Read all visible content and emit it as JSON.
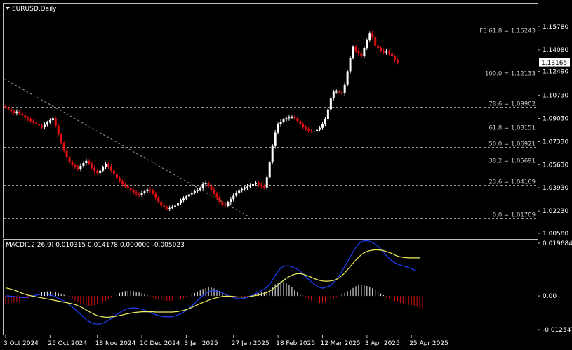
{
  "chart_data": {
    "type": "candlestick",
    "symbol_title": "EURUSD,Daily",
    "price_axis": {
      "ylim": [
        1.0058,
        1.1578
      ],
      "ticks": [
        "1.15780",
        "1.14080",
        "1.12490",
        "1.10730",
        "1.09030",
        "1.07330",
        "1.05630",
        "1.03930",
        "1.02230",
        "1.00580"
      ],
      "tick_values": [
        1.1578,
        1.1408,
        1.1249,
        1.1073,
        1.0903,
        1.0733,
        1.0563,
        1.0393,
        1.0223,
        1.0058
      ],
      "current_price": "1.13165",
      "current_value": 1.13165
    },
    "fib_levels": [
      {
        "label": "FE 61.8 = 1.15243",
        "value": 1.15243
      },
      {
        "label": "100.0 = 1.12133",
        "value": 1.12133
      },
      {
        "label": "78.6 = 1.09902",
        "value": 1.09902
      },
      {
        "label": "61.8 = 1.08151",
        "value": 1.08151
      },
      {
        "label": "50.0 = 1.06921",
        "value": 1.06921
      },
      {
        "label": "38.2 = 1.05691",
        "value": 1.05691
      },
      {
        "label": "23.6 = 1.04169",
        "value": 1.04169
      },
      {
        "label": "0.0 = 1.01709",
        "value": 1.01709
      }
    ],
    "trendline": {
      "from": [
        "3 Oct 2024",
        1.1195
      ],
      "to": [
        "10 Feb 2025",
        1.0175
      ]
    },
    "x_axis": {
      "labels": [
        "3 Oct 2024",
        "25 Oct 2024",
        "18 Nov 2024",
        "10 Dec 2024",
        "3 Jan 2025",
        "27 Jan 2025",
        "18 Feb 2025",
        "12 Mar 2025",
        "3 Apr 2025",
        "25 Apr 2025"
      ],
      "label_bar_index": [
        0,
        16,
        33,
        49,
        65,
        82,
        98,
        114,
        130,
        146
      ]
    },
    "candle_count": 152,
    "close_series": [
      1.0985,
      1.0972,
      1.0957,
      1.0942,
      1.0954,
      1.0938,
      1.0925,
      1.0908,
      1.0896,
      1.0884,
      1.0872,
      1.0862,
      1.0852,
      1.0842,
      1.0858,
      1.0874,
      1.089,
      1.0905,
      1.085,
      1.0785,
      1.0725,
      1.0665,
      1.0615,
      1.0582,
      1.056,
      1.0545,
      1.053,
      1.0555,
      1.0575,
      1.0592,
      1.057,
      1.054,
      1.0515,
      1.0502,
      1.052,
      1.0545,
      1.0565,
      1.055,
      1.052,
      1.0492,
      1.0465,
      1.044,
      1.042,
      1.0405,
      1.039,
      1.0375,
      1.036,
      1.0348,
      1.034,
      1.0355,
      1.0368,
      1.038,
      1.0372,
      1.035,
      1.032,
      1.029,
      1.0262,
      1.025,
      1.024,
      1.0245,
      1.0255,
      1.0262,
      1.028,
      1.03,
      1.0315,
      1.033,
      1.0345,
      1.0358,
      1.0368,
      1.0378,
      1.039,
      1.042,
      1.043,
      1.0405,
      1.038,
      1.035,
      1.032,
      1.029,
      1.027,
      1.026,
      1.0285,
      1.031,
      1.0335,
      1.0355,
      1.0372,
      1.0385,
      1.0395,
      1.0402,
      1.041,
      1.042,
      1.043,
      1.0415,
      1.0405,
      1.0395,
      1.047,
      1.058,
      1.07,
      1.08,
      1.086,
      1.088,
      1.0895,
      1.0905,
      1.091,
      1.0912,
      1.0905,
      1.0885,
      1.086,
      1.084,
      1.0825,
      1.0815,
      1.081,
      1.0812,
      1.082,
      1.0835,
      1.086,
      1.09,
      1.097,
      1.105,
      1.11,
      1.11,
      1.1095,
      1.109,
      1.115,
      1.125,
      1.135,
      1.143,
      1.14,
      1.138,
      1.136,
      1.142,
      1.148,
      1.153,
      1.15,
      1.144,
      1.142,
      1.14,
      1.139,
      1.1395,
      1.138,
      1.136,
      1.133,
      1.1316
    ],
    "macd": {
      "title": "MACD(12,26,9) 0.010315 0.014178 0.000000 -0.005023",
      "ylim": [
        -0.012547,
        0.019684
      ],
      "ticks": [
        "0.019684",
        "0.00",
        "-0.012547"
      ],
      "tick_values": [
        0.019684,
        0.0,
        -0.012547
      ],
      "histogram": [
        -0.003,
        -0.0028,
        -0.0026,
        -0.0024,
        -0.0022,
        -0.0019,
        -0.0016,
        -0.0012,
        -0.0008,
        -0.0004,
        0.0001,
        0.0006,
        0.001,
        0.0013,
        0.0016,
        0.0017,
        0.0017,
        0.0016,
        0.0014,
        0.0011,
        0.0008,
        0.0004,
        0.0,
        -0.0006,
        -0.0012,
        -0.0018,
        -0.0024,
        -0.0029,
        -0.0033,
        -0.0036,
        -0.0037,
        -0.0037,
        -0.0035,
        -0.0032,
        -0.0028,
        -0.0023,
        -0.0018,
        -0.0012,
        -0.0006,
        0.0001,
        0.0006,
        0.0011,
        0.0015,
        0.0018,
        0.0019,
        0.0019,
        0.0018,
        0.0016,
        0.0013,
        0.001,
        0.0006,
        0.0002,
        -0.0002,
        -0.0006,
        -0.001,
        -0.0013,
        -0.0016,
        -0.0017,
        -0.0018,
        -0.0018,
        -0.0017,
        -0.0015,
        -0.0013,
        -0.001,
        -0.0007,
        -0.0003,
        0.0001,
        0.0006,
        0.0011,
        0.0016,
        0.0021,
        0.0026,
        0.003,
        0.0032,
        0.0031,
        0.0028,
        0.0024,
        0.0019,
        0.0013,
        0.0008,
        0.0003,
        -0.0001,
        -0.0004,
        -0.0006,
        -0.0007,
        -0.0006,
        -0.0004,
        -0.0002,
        0.0001,
        0.0004,
        0.0007,
        0.001,
        0.0013,
        0.0016,
        0.002,
        0.0026,
        0.0034,
        0.0044,
        0.005,
        0.0054,
        0.0052,
        0.0047,
        0.004,
        0.0032,
        0.0024,
        0.0016,
        0.0008,
        0.0001,
        -0.0006,
        -0.0012,
        -0.0017,
        -0.0021,
        -0.0024,
        -0.0026,
        -0.0026,
        -0.0024,
        -0.0021,
        -0.0017,
        -0.0012,
        -0.0006,
        0.0,
        0.0006,
        0.0012,
        0.0018,
        0.0024,
        0.003,
        0.0036,
        0.004,
        0.0041,
        0.004,
        0.0037,
        0.0033,
        0.0028,
        0.0022,
        0.0016,
        0.0009,
        0.0003,
        -0.0003,
        -0.0009,
        -0.0014,
        -0.0019,
        -0.0023,
        -0.0026,
        -0.0028,
        -0.003,
        -0.0032,
        -0.0034,
        -0.0036,
        -0.004,
        -0.0045,
        -0.005
      ],
      "signal": [
        0.003,
        0.0028,
        0.0025,
        0.0022,
        0.0018,
        0.0014,
        0.001,
        0.0006,
        0.0003,
        0.0001,
        -0.0001,
        -0.0003,
        -0.0005,
        -0.0007,
        -0.0009,
        -0.0011,
        -0.0013,
        -0.0015,
        -0.0017,
        -0.0019,
        -0.0021,
        -0.0023,
        -0.0025,
        -0.0027,
        -0.0029,
        -0.0032,
        -0.0036,
        -0.004,
        -0.0046,
        -0.0052,
        -0.0058,
        -0.0064,
        -0.0069,
        -0.0073,
        -0.0076,
        -0.0078,
        -0.0079,
        -0.0079,
        -0.0078,
        -0.0077,
        -0.0075,
        -0.0073,
        -0.0071,
        -0.0068,
        -0.0066,
        -0.0064,
        -0.0062,
        -0.0061,
        -0.006,
        -0.0059,
        -0.0059,
        -0.0059,
        -0.0059,
        -0.0059,
        -0.006,
        -0.006,
        -0.006,
        -0.006,
        -0.006,
        -0.006,
        -0.006,
        -0.0059,
        -0.0058,
        -0.0056,
        -0.0054,
        -0.0051,
        -0.0047,
        -0.0043,
        -0.0038,
        -0.0033,
        -0.0028,
        -0.0024,
        -0.002,
        -0.0016,
        -0.0012,
        -0.0009,
        -0.0006,
        -0.0004,
        -0.0002,
        -0.0001,
        -0.0001,
        -0.0001,
        -0.0002,
        -0.0003,
        -0.0004,
        -0.0004,
        -0.0004,
        -0.0003,
        -0.0002,
        0.0,
        0.0002,
        0.0004,
        0.0006,
        0.0009,
        0.0013,
        0.0018,
        0.0025,
        0.0033,
        0.0041,
        0.005,
        0.0058,
        0.0066,
        0.0072,
        0.0077,
        0.0081,
        0.0083,
        0.0083,
        0.0081,
        0.0078,
        0.0074,
        0.007,
        0.0065,
        0.0061,
        0.0058,
        0.0056,
        0.0055,
        0.0055,
        0.0056,
        0.0058,
        0.0062,
        0.0068,
        0.0076,
        0.0086,
        0.0098,
        0.011,
        0.0122,
        0.0134,
        0.0145,
        0.0154,
        0.0161,
        0.0166,
        0.0169,
        0.0171,
        0.0172,
        0.0172,
        0.0171,
        0.0169,
        0.0166,
        0.0162,
        0.0158,
        0.0153,
        0.0149,
        0.0146,
        0.0144,
        0.0143,
        0.0142,
        0.0142,
        0.0142,
        0.0142,
        0.0142
      ],
      "macd_line": [
        0.0,
        0.0,
        -0.0001,
        -0.0002,
        -0.0004,
        -0.0005,
        -0.0006,
        -0.0006,
        -0.0005,
        -0.0003,
        0.0,
        0.0003,
        0.0005,
        0.0006,
        0.0007,
        0.0006,
        0.0004,
        0.0001,
        -0.0003,
        -0.0008,
        -0.0013,
        -0.0019,
        -0.0025,
        -0.0033,
        -0.0041,
        -0.005,
        -0.006,
        -0.0069,
        -0.0079,
        -0.0088,
        -0.0095,
        -0.0101,
        -0.0104,
        -0.0105,
        -0.0104,
        -0.0101,
        -0.0097,
        -0.0091,
        -0.0084,
        -0.0076,
        -0.0069,
        -0.0062,
        -0.0056,
        -0.005,
        -0.0047,
        -0.0045,
        -0.0044,
        -0.0045,
        -0.0047,
        -0.0049,
        -0.0053,
        -0.0057,
        -0.0061,
        -0.0065,
        -0.007,
        -0.0073,
        -0.0076,
        -0.0077,
        -0.0078,
        -0.0078,
        -0.0077,
        -0.0074,
        -0.0071,
        -0.0066,
        -0.0061,
        -0.0054,
        -0.0046,
        -0.0037,
        -0.0027,
        -0.0017,
        -0.0007,
        0.0002,
        0.001,
        0.0016,
        0.0019,
        0.0019,
        0.0018,
        0.0015,
        0.0011,
        0.0007,
        0.0002,
        -0.0002,
        -0.0006,
        -0.0009,
        -0.0011,
        -0.001,
        -0.0008,
        -0.0005,
        -0.0001,
        0.0004,
        0.0009,
        0.0014,
        0.0019,
        0.0025,
        0.0033,
        0.0044,
        0.0059,
        0.0077,
        0.0091,
        0.0104,
        0.011,
        0.0113,
        0.0112,
        0.0109,
        0.0105,
        0.0099,
        0.0091,
        0.0082,
        0.0072,
        0.0062,
        0.0053,
        0.0044,
        0.0037,
        0.0032,
        0.0029,
        0.0031,
        0.0035,
        0.0041,
        0.005,
        0.0062,
        0.0076,
        0.0092,
        0.011,
        0.0128,
        0.0146,
        0.0164,
        0.018,
        0.0194,
        0.0202,
        0.0206,
        0.0206,
        0.0204,
        0.0199,
        0.0193,
        0.0185,
        0.0175,
        0.0162,
        0.015,
        0.014,
        0.013,
        0.0124,
        0.0119,
        0.0115,
        0.0112,
        0.0109,
        0.0106,
        0.0102,
        0.0097,
        0.0092
      ]
    }
  }
}
